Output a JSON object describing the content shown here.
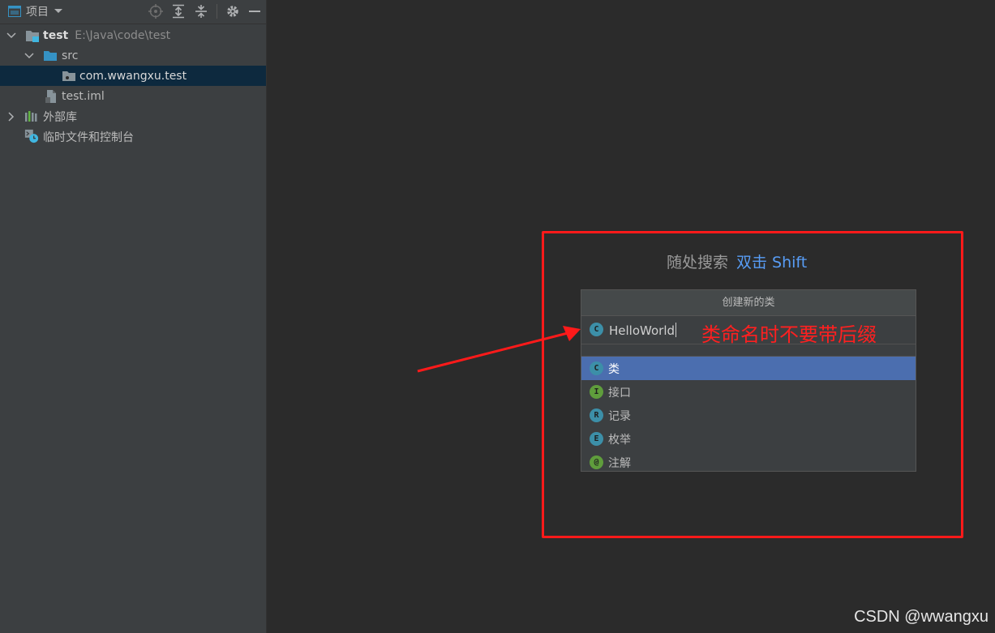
{
  "project_panel": {
    "title": "项目",
    "tree": [
      {
        "label": "test",
        "path": "E:\\Java\\code\\test"
      },
      {
        "label": "src"
      },
      {
        "label": "com.wwangxu.test"
      },
      {
        "label": "test.iml"
      },
      {
        "label": "外部库"
      },
      {
        "label": "临时文件和控制台"
      }
    ]
  },
  "editor": {
    "hint_text": "随处搜索",
    "hint_shortcut": "双击 Shift"
  },
  "dialog": {
    "title": "创建新的类",
    "input_value": "HelloWorld",
    "input_badge": "C",
    "options": [
      {
        "badge": "C",
        "label": "类",
        "selected": true
      },
      {
        "badge": "I",
        "label": "接口"
      },
      {
        "badge": "R",
        "label": "记录"
      },
      {
        "badge": "E",
        "label": "枚举"
      },
      {
        "badge": "@",
        "label": "注解"
      }
    ]
  },
  "annotation": {
    "note": "类命名时不要带后缀",
    "color": "#ff1a1a"
  },
  "watermark": "CSDN @wwangxu"
}
